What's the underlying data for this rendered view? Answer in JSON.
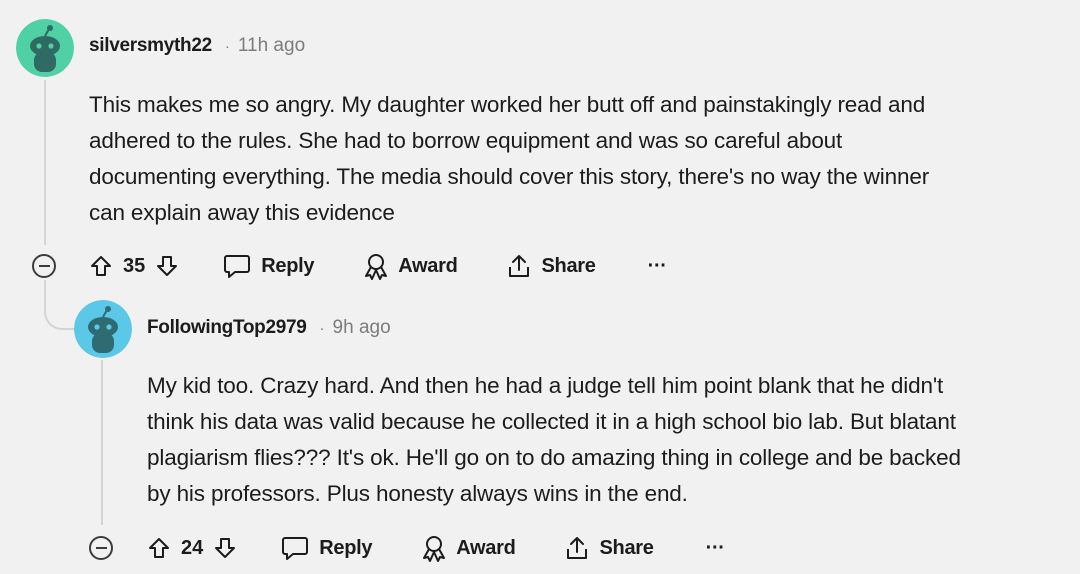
{
  "comments": [
    {
      "username": "silversmyth22",
      "separator": "·",
      "time": "11h ago",
      "lines": [
        "This makes me so angry. My daughter worked her butt off and painstakingly read and",
        "adhered to the rules. She had to borrow equipment and was so careful about",
        "documenting everything. The media should cover this story, there's no way the winner",
        "can explain away this evidence"
      ],
      "votes": "35",
      "reply_label": "Reply",
      "award_label": "Award",
      "share_label": "Share",
      "more_label": "···",
      "avatar_color": "#4fd1a5"
    },
    {
      "username": "FollowingTop2979",
      "separator": "·",
      "time": "9h ago",
      "lines": [
        "My kid too. Crazy hard. And then he had a judge tell him point blank that he didn't",
        "think his data was valid because he collected it in a high school bio lab. But blatant",
        "plagiarism flies??? It's ok. He'll go on to do amazing thing in college and be backed",
        "by his professors. Plus honesty always wins in the end."
      ],
      "votes": "24",
      "reply_label": "Reply",
      "award_label": "Award",
      "share_label": "Share",
      "more_label": "···",
      "avatar_color": "#5bc8e8"
    }
  ]
}
